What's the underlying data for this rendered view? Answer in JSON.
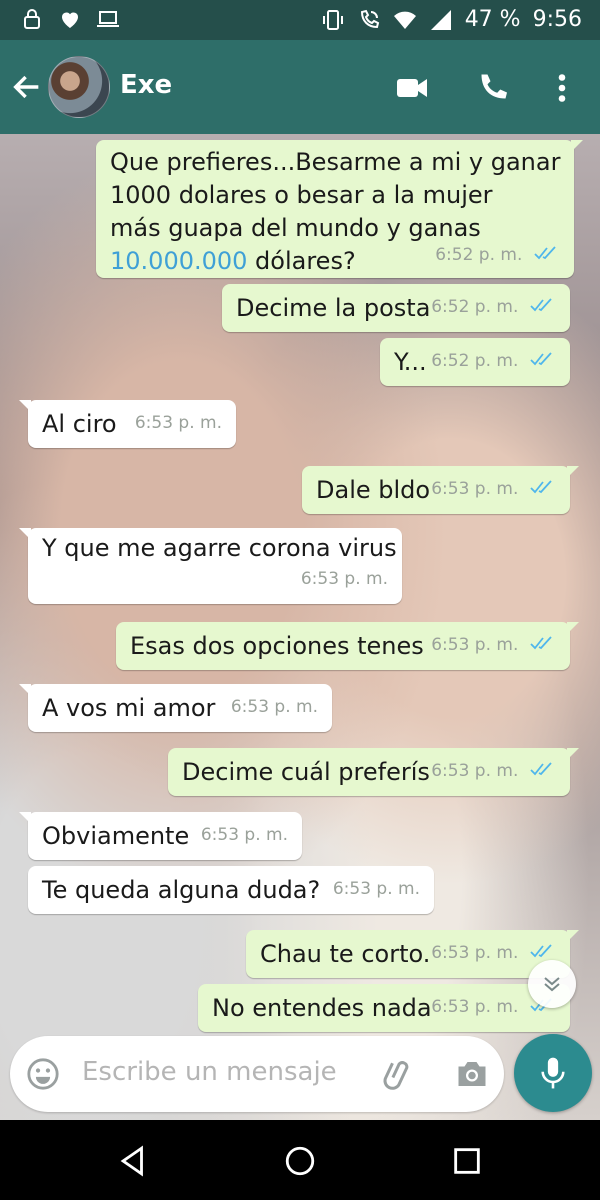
{
  "status_bar": {
    "left_icons": [
      "lock-icon",
      "heart-icon",
      "laptop-icon"
    ],
    "right_icons": [
      "vibrate-icon",
      "wifi-call-icon",
      "wifi-icon",
      "signal-icon"
    ],
    "battery": "47 %",
    "time": "9:56"
  },
  "header": {
    "contact_name": "Exe",
    "icons": [
      "back-arrow-icon",
      "video-call-icon",
      "phone-icon",
      "more-vert-icon"
    ]
  },
  "messages": [
    {
      "dir": "out",
      "lines": [
        "Que prefieres...Besarme a mi y ganar",
        "1000 dolares o besar a la mujer",
        "más guapa del mundo y ganas"
      ],
      "link": "10.000.000",
      "tail": " dólares?",
      "time": "6:52 p. m.",
      "read": true
    },
    {
      "dir": "out",
      "text": "Decime la posta",
      "time": "6:52 p. m.",
      "read": true
    },
    {
      "dir": "out",
      "text": "Y...",
      "time": "6:52 p. m.",
      "read": true
    },
    {
      "dir": "in",
      "text": "Al ciro",
      "time": "6:53 p. m."
    },
    {
      "dir": "out",
      "text": "Dale bldo",
      "time": "6:53 p. m.",
      "read": true
    },
    {
      "dir": "in",
      "text": "Y que me agarre corona virus",
      "time": "6:53 p. m."
    },
    {
      "dir": "out",
      "text": "Esas dos opciones tenes",
      "time": "6:53 p. m.",
      "read": true
    },
    {
      "dir": "in",
      "text": "A vos mi amor",
      "time": "6:53 p. m."
    },
    {
      "dir": "out",
      "text": "Decime cuál preferís",
      "time": "6:53 p. m.",
      "read": true
    },
    {
      "dir": "in",
      "text": "Obviamente",
      "time": "6:53 p. m."
    },
    {
      "dir": "in",
      "text": "Te queda alguna duda?",
      "time": "6:53 p. m."
    },
    {
      "dir": "out",
      "text": "Chau te corto.",
      "time": "6:53 p. m.",
      "read": true
    },
    {
      "dir": "out",
      "text": "No entendes nada",
      "time": "6:53 p. m.",
      "read": true
    }
  ],
  "composer": {
    "placeholder": "Escribe un mensaje",
    "icons": [
      "emoji-icon",
      "attach-icon",
      "camera-icon",
      "mic-icon"
    ]
  },
  "nav_bar": {
    "icons": [
      "nav-back-icon",
      "nav-home-icon",
      "nav-recents-icon"
    ]
  },
  "colors": {
    "header": "#2e6e69",
    "status_bar": "#254f4b",
    "outgoing_bubble": "#e6f8cf",
    "incoming_bubble": "#ffffff",
    "read_ticks": "#4fb6ec",
    "mic_button": "#2c8b8f"
  }
}
